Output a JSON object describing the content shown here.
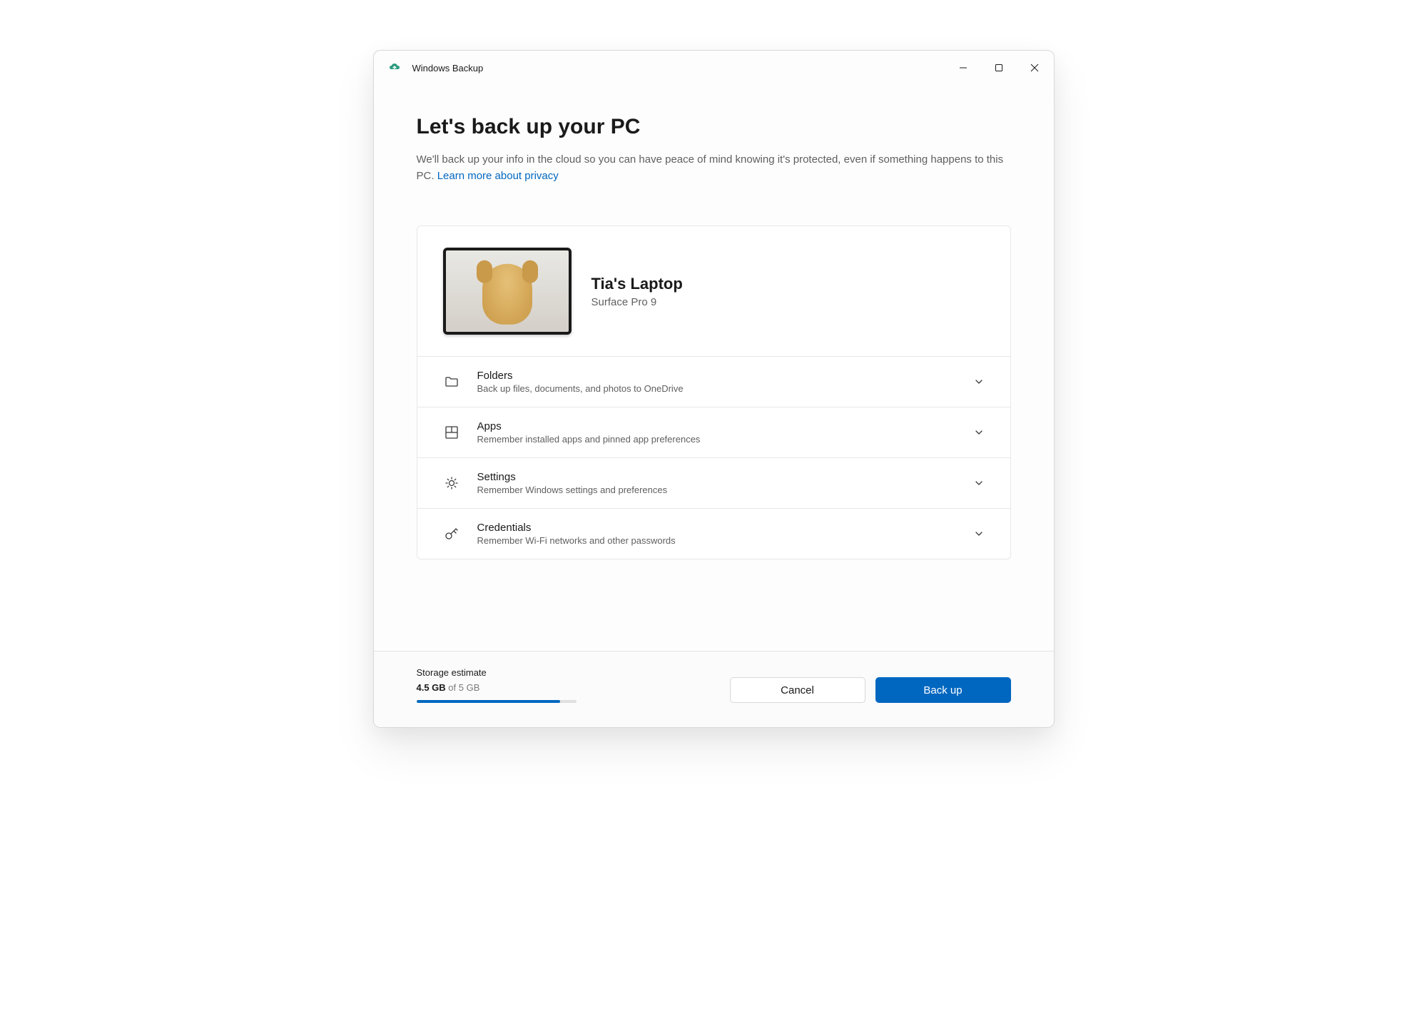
{
  "window": {
    "title": "Windows Backup"
  },
  "header": {
    "heading": "Let's back up your PC",
    "subtext_a": "We'll back up your info in the cloud so you can have peace of mind knowing it's protected, even if something happens to this PC.",
    "privacy_link": "Learn more about privacy"
  },
  "device": {
    "name": "Tia's Laptop",
    "model": "Surface Pro 9"
  },
  "sections": [
    {
      "icon": "folder-icon",
      "title": "Folders",
      "desc": "Back up files, documents, and photos to OneDrive"
    },
    {
      "icon": "apps-icon",
      "title": "Apps",
      "desc": "Remember installed apps and pinned app preferences"
    },
    {
      "icon": "gear-icon",
      "title": "Settings",
      "desc": "Remember Windows settings and preferences"
    },
    {
      "icon": "key-icon",
      "title": "Credentials",
      "desc": "Remember Wi-Fi networks and other passwords"
    }
  ],
  "storage": {
    "label": "Storage estimate",
    "used": "4.5 GB",
    "total_text": " of 5 GB",
    "percent": 90
  },
  "footer": {
    "cancel": "Cancel",
    "backup": "Back up"
  },
  "colors": {
    "accent": "#0067c0"
  }
}
